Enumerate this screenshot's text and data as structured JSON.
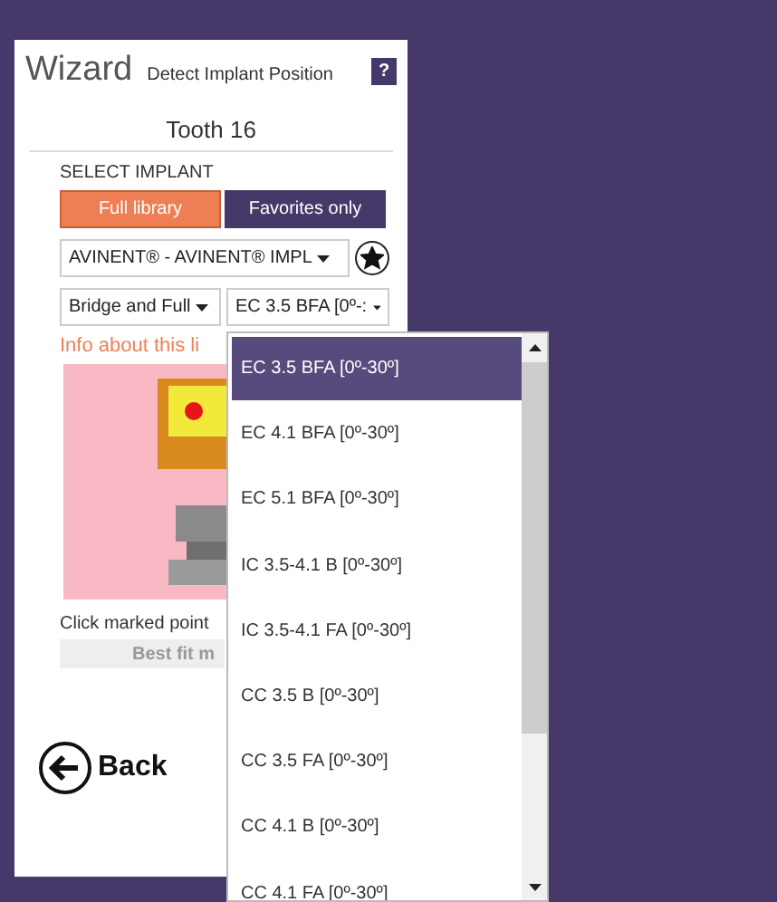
{
  "wizard": {
    "title": "Wizard",
    "subtitle": "Detect Implant Position",
    "help": "?",
    "tooth": "Tooth 16",
    "section_label": "SELECT IMPLANT",
    "library_tabs": [
      {
        "label": "Full library",
        "selected": true
      },
      {
        "label": "Favorites only",
        "selected": false
      }
    ],
    "manufacturer": "AVINENT® - AVINENT® IMPL",
    "favorite": true,
    "type_select": "Bridge and Full",
    "model_select": "EC 3.5 BFA [0º-:",
    "info_link": "Info about this li",
    "instruction": "Click marked point",
    "best_fit_button": "Best fit m",
    "back_button": "Back"
  },
  "model_dropdown": {
    "items": [
      {
        "label": "EC 3.5 BFA [0º-30º]",
        "selected": true
      },
      {
        "label": "EC 4.1 BFA [0º-30º]",
        "selected": false
      },
      {
        "label": "EC 5.1 BFA [0º-30º]",
        "selected": false
      },
      {
        "label": "IC 3.5-4.1 B [0º-30º]",
        "selected": false
      },
      {
        "label": "IC 3.5-4.1 FA [0º-30º]",
        "selected": false
      },
      {
        "label": "CC 3.5 B [0º-30º]",
        "selected": false
      },
      {
        "label": "CC 3.5 FA [0º-30º]",
        "selected": false
      },
      {
        "label": "CC 4.1 B [0º-30º]",
        "selected": false
      },
      {
        "label": "CC 4.1 FA [0º-30º]",
        "selected": false
      }
    ]
  }
}
